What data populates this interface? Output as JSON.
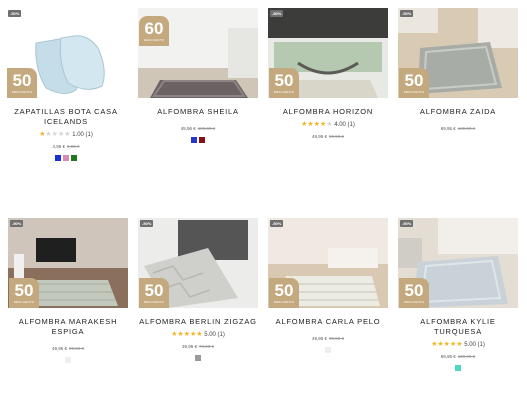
{
  "products": [
    {
      "title_line1": "ZAPATILLAS BOTA CASA",
      "title_line2": "ICELANDS",
      "discount": "-50%",
      "badge_num": "50",
      "badge_text": "DESCUENTO",
      "rating": "1.00",
      "reviews": "(1)",
      "stars_filled": 1,
      "price": "4,95 €",
      "old_price": "9,90 €",
      "swatches": [
        "#1a2fd6",
        "#d989b8",
        "#1f7a1f"
      ]
    },
    {
      "title_line1": "ALFOMBRA SHEILA",
      "title_line2": "",
      "discount": "",
      "badge_num": "60",
      "badge_text": "DESCUENTO",
      "rating": "",
      "reviews": "",
      "stars_filled": 0,
      "price": "45,96 €",
      "old_price": "109,90 €",
      "swatches": [
        "#2439c9",
        "#7e1418"
      ]
    },
    {
      "title_line1": "ALFOMBRA HORIZON",
      "title_line2": "",
      "discount": "-50%",
      "badge_num": "50",
      "badge_text": "DESCUENTO",
      "rating": "4.00",
      "reviews": "(1)",
      "stars_filled": 4,
      "price": "49,95 €",
      "old_price": "99,90 €",
      "swatches": []
    },
    {
      "title_line1": "ALFOMBRA ZAIDA",
      "title_line2": "",
      "discount": "-50%",
      "badge_num": "50",
      "badge_text": "DESCUENTO",
      "rating": "",
      "reviews": "",
      "stars_filled": 0,
      "price": "69,95 €",
      "old_price": "139,90 €",
      "swatches": []
    },
    {
      "title_line1": "ALFOMBRA MARAKESH ESPIGA",
      "title_line2": "",
      "discount": "-50%",
      "badge_num": "50",
      "badge_text": "DESCUENTO",
      "rating": "",
      "reviews": "",
      "stars_filled": 0,
      "price": "49,95 €",
      "old_price": "99,90 €",
      "swatches": [
        "#eeeeee"
      ]
    },
    {
      "title_line1": "ALFOMBRA BERLIN ZIGZAG",
      "title_line2": "",
      "discount": "-50%",
      "badge_num": "50",
      "badge_text": "DESCUENTO",
      "rating": "5.00",
      "reviews": "(1)",
      "stars_filled": 5,
      "price": "39,95 €",
      "old_price": "79,90 €",
      "swatches": [
        "#9a9a9a"
      ]
    },
    {
      "title_line1": "ALFOMBRA CARLA PELO",
      "title_line2": "",
      "discount": "-50%",
      "badge_num": "50",
      "badge_text": "DESCUENTO",
      "rating": "",
      "reviews": "",
      "stars_filled": 0,
      "price": "49,95 €",
      "old_price": "99,90 €",
      "swatches": [
        "#eeeeee"
      ]
    },
    {
      "title_line1": "ALFOMBRA KYLIE TURQUESA",
      "title_line2": "",
      "discount": "-50%",
      "badge_num": "50",
      "badge_text": "DESCUENTO",
      "rating": "5.00",
      "reviews": "(1)",
      "stars_filled": 5,
      "price": "69,95 €",
      "old_price": "139,90 €",
      "swatches": [
        "#52d6c8"
      ]
    }
  ]
}
